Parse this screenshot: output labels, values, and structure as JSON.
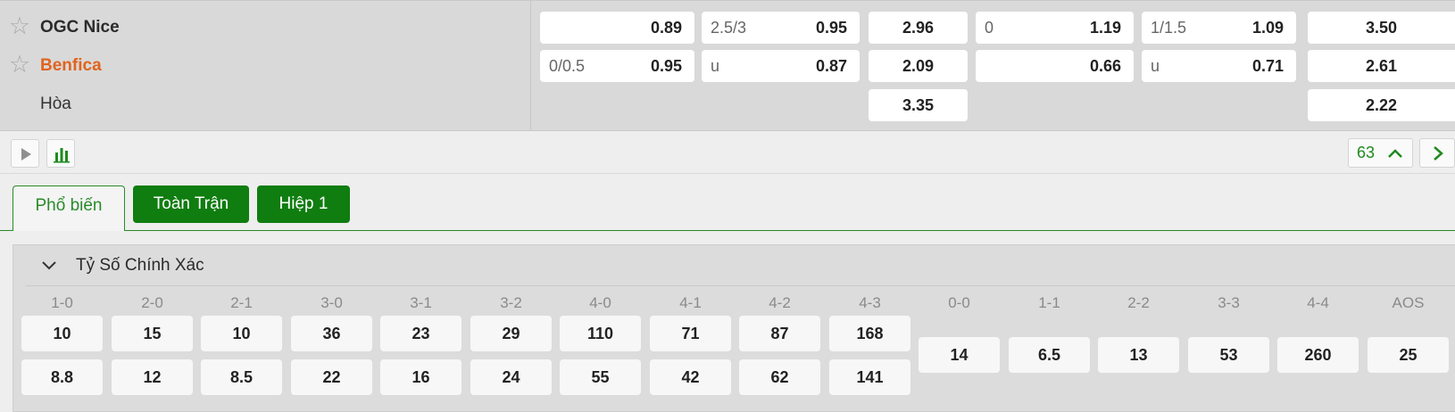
{
  "match": {
    "home": {
      "name": "OGC Nice"
    },
    "away": {
      "name": "Benfica"
    },
    "draw": {
      "name": "Hòa"
    }
  },
  "odds": {
    "home": {
      "handicap": {
        "line": "",
        "value": "0.89"
      },
      "over_under": {
        "line": "2.5/3",
        "value": "0.95"
      },
      "one_x_two": "2.96",
      "half_handicap": {
        "line": "0",
        "value": "1.19"
      },
      "half_over_under": {
        "line": "1/1.5",
        "value": "1.09"
      },
      "half_one_x_two": "3.50"
    },
    "away": {
      "handicap": {
        "line": "0/0.5",
        "value": "0.95"
      },
      "over_under": {
        "line": "u",
        "value": "0.87"
      },
      "one_x_two": "2.09",
      "half_handicap": {
        "line": "",
        "value": "0.66"
      },
      "half_over_under": {
        "line": "u",
        "value": "0.71"
      },
      "half_one_x_two": "2.61"
    },
    "draw": {
      "one_x_two": "3.35",
      "half_one_x_two": "2.22"
    }
  },
  "toolbar": {
    "play_icon": "play-icon",
    "stats_icon": "bar-chart-icon",
    "more_count": "63",
    "collapse_icon": "chevron-up-icon",
    "next_icon": "chevron-right-icon"
  },
  "tabs": [
    {
      "label": "Phổ biến",
      "active": true
    },
    {
      "label": "Toàn Trận",
      "active": false
    },
    {
      "label": "Hiệp 1",
      "active": false
    }
  ],
  "correct_score": {
    "title": "Tỷ Số Chính Xác",
    "two_row": [
      {
        "score": "1-0",
        "home": "10",
        "away": "8.8"
      },
      {
        "score": "2-0",
        "home": "15",
        "away": "12"
      },
      {
        "score": "2-1",
        "home": "10",
        "away": "8.5"
      },
      {
        "score": "3-0",
        "home": "36",
        "away": "22"
      },
      {
        "score": "3-1",
        "home": "23",
        "away": "16"
      },
      {
        "score": "3-2",
        "home": "29",
        "away": "24"
      },
      {
        "score": "4-0",
        "home": "110",
        "away": "55"
      },
      {
        "score": "4-1",
        "home": "71",
        "away": "42"
      },
      {
        "score": "4-2",
        "home": "87",
        "away": "62"
      },
      {
        "score": "4-3",
        "home": "168",
        "away": "141"
      }
    ],
    "single": [
      {
        "score": "0-0",
        "value": "14"
      },
      {
        "score": "1-1",
        "value": "6.5"
      },
      {
        "score": "2-2",
        "value": "13"
      },
      {
        "score": "3-3",
        "value": "53"
      },
      {
        "score": "4-4",
        "value": "260"
      },
      {
        "score": "AOS",
        "value": "25"
      }
    ]
  },
  "colors": {
    "accent_green": "#0f7d0f",
    "away_team": "#e0641e"
  }
}
